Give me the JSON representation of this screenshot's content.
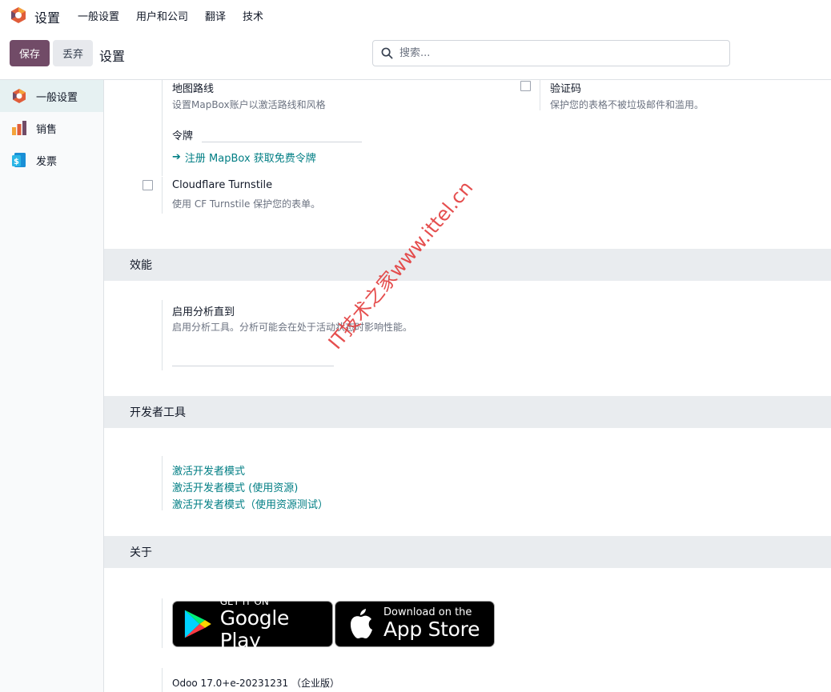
{
  "navbar": {
    "app_title": "设置",
    "menu": [
      "一般设置",
      "用户和公司",
      "翻译",
      "技术"
    ]
  },
  "control_panel": {
    "save_label": "保存",
    "discard_label": "丢弃",
    "breadcrumb": "设置",
    "search_placeholder": "搜索..."
  },
  "sidebar": {
    "items": [
      {
        "label": "一般设置",
        "icon": "odoo-settings-icon",
        "active": true
      },
      {
        "label": "销售",
        "icon": "sales-chart-icon",
        "active": false
      },
      {
        "label": "发票",
        "icon": "invoice-icon",
        "active": false
      }
    ]
  },
  "integrations": {
    "map_routes": {
      "title": "地图路线",
      "desc": "设置MapBox账户以激活路线和风格",
      "token_label": "令牌",
      "token_value": "",
      "link": "注册 MapBox 获取免费令牌"
    },
    "captcha": {
      "title": "验证码",
      "desc": "保护您的表格不被垃圾邮件和滥用。",
      "checked": false
    },
    "turnstile": {
      "title": "Cloudflare Turnstile",
      "desc": "使用 CF Turnstile 保护您的表单。",
      "checked": false
    }
  },
  "performance": {
    "header": "效能",
    "profiling_title": "启用分析直到",
    "profiling_desc": "启用分析工具。分析可能会在处于活动状态时影响性能。",
    "profiling_value": ""
  },
  "developer_tools": {
    "header": "开发者工具",
    "links": [
      "激活开发者模式",
      "激活开发者模式 (使用资源)",
      "激活开发者模式（使用资源测试）"
    ]
  },
  "about": {
    "header": "关于",
    "google_play": {
      "small": "GET IT ON",
      "big": "Google Play"
    },
    "app_store": {
      "small": "Download on the",
      "big": "App Store"
    },
    "version": "Odoo 17.0+e-20231231 （企业版）"
  },
  "watermark": "IT技术之家www.ittel.cn",
  "colors": {
    "primary": "#714B67",
    "link": "#017e84",
    "section_bg": "#e9ecef",
    "watermark": "#e33b3b"
  }
}
